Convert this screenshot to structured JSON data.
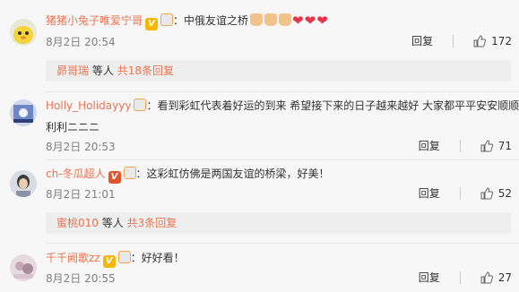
{
  "comments": [
    {
      "name": "猪猪小兔子唯爱宁哥",
      "text": "：中俄友谊之桥",
      "date": "8月2日 20:54",
      "reply_label": "回复",
      "likes": "172",
      "subreply": {
        "user": "昴哥瑞",
        "middle": "等人",
        "more": "共18条回复"
      }
    },
    {
      "name": "Holly_Holidayyy",
      "text": "：看到彩虹代表着好运的到来 希望接下来的日子越来越好 大家都平平安安顺顺",
      "text2": "利利ニニニ",
      "date": "8月2日 20:53",
      "reply_label": "回复",
      "likes": "71"
    },
    {
      "name": "ch-冬瓜超人",
      "text": "：这彩虹仿佛是两国友谊的桥梁，好美！",
      "date": "8月2日 21:01",
      "reply_label": "回复",
      "likes": "52",
      "subreply": {
        "user": "蜜桃010",
        "middle": "等人",
        "more": "共3条回复"
      }
    },
    {
      "name": "千千阙歌zz",
      "text": "：好好看！",
      "date": "8月2日 20:55",
      "reply_label": "回复",
      "likes": "27"
    }
  ],
  "icons": {
    "like": "thumbs-up-icon",
    "badge": "vip-badge-icon",
    "emoji_thumb": "thumb-emoji-icon",
    "emoji_heart": "heart-emoji-icon"
  }
}
